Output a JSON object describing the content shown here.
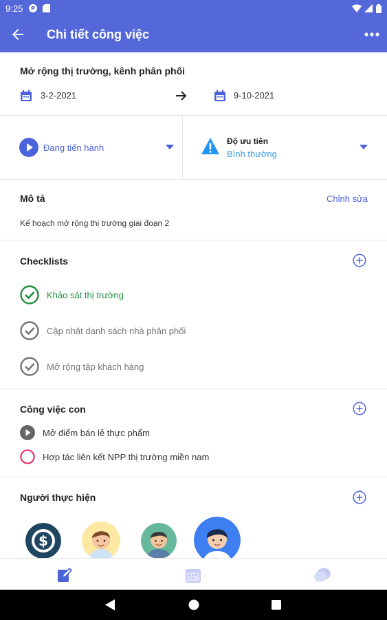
{
  "status_bar": {
    "time": "9:25"
  },
  "app_bar": {
    "title": "Chi tiết công việc"
  },
  "task": {
    "title": "Mở rộng thị trường, kênh phân phối",
    "start_date": "3-2-2021",
    "end_date": "9-10-2021"
  },
  "status": {
    "label": "Đang tiến hành"
  },
  "priority": {
    "label": "Độ ưu tiên",
    "value": "Bình thường"
  },
  "description": {
    "title": "Mô tả",
    "edit_label": "Chỉnh sửa",
    "text": "Kế hoạch mở rộng thị trường giai đoạn 2"
  },
  "checklists": {
    "title": "Checklists",
    "items": [
      {
        "label": "Khảo sát thị trường",
        "done": true
      },
      {
        "label": "Cập nhật danh sách nhà phân phối",
        "done": false
      },
      {
        "label": "Mở rộng tập khách hàng",
        "done": false
      }
    ]
  },
  "subtasks": {
    "title": "Công việc con",
    "items": [
      {
        "label": "Mở điểm bán lẻ thực phẩm",
        "state": "in-progress"
      },
      {
        "label": "Hợp tác liên kết NPP thị trường miền nam",
        "state": "not-started"
      }
    ]
  },
  "assignees": {
    "title": "Người thực hiện",
    "count": 4
  },
  "colors": {
    "primary": "#5468d9",
    "success": "#1e8e3e",
    "link": "#4a63d9",
    "priority_value": "#3b9be0",
    "not_started": "#e91e63"
  }
}
